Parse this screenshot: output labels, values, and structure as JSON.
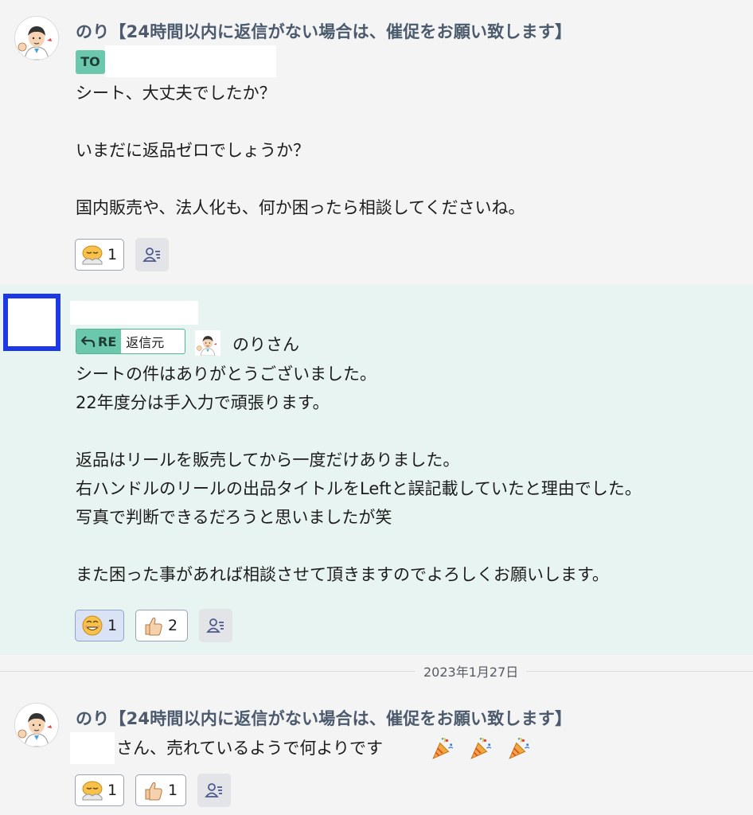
{
  "messages": [
    {
      "sender": "のり【24時間以内に返信がない場合は、催促をお願い致します】",
      "to_label": "TO",
      "lines": "シート、大丈夫でしたか？\n\nいまだに返品ゼロでしょうか？\n\n国内販売や、法人化も、何か困ったら相談してくださいね。",
      "reactions": [
        {
          "icon": "bow-emoji",
          "count": "1"
        }
      ],
      "readers_icon": "readers-list-icon"
    },
    {
      "reply_label": "RE",
      "reply_source": "返信元",
      "reply_to_name": "のりさん",
      "lines": "シートの件はありがとうございました。\n22年度分は手入力で頑張ります。\n\n返品はリールを販売してから一度だけありました。\n右ハンドルのリールの出品タイトルをLeftと誤記載していたと理由でした。\n写真で判断できるだろうと思いましたが笑\n\nまた困った事があれば相談させて頂きますのでよろしくお願いします。",
      "reactions": [
        {
          "icon": "grin-emoji",
          "count": "1"
        },
        {
          "icon": "thumbs-up-emoji",
          "count": "2"
        }
      ],
      "readers_icon": "readers-list-icon"
    },
    {
      "sender": "のり【24時間以内に返信がない場合は、催促をお願い致します】",
      "text": "さん、売れているようで何よりです",
      "party_icons": [
        "party-popper-icon",
        "party-popper-icon",
        "party-popper-icon"
      ],
      "reactions": [
        {
          "icon": "bow-emoji",
          "count": "1"
        },
        {
          "icon": "thumbs-up-emoji",
          "count": "1"
        }
      ],
      "readers_icon": "readers-list-icon"
    }
  ],
  "date_divider": "2023年1月27日",
  "colors": {
    "accent_green": "#6cc8ad",
    "highlight_bg": "#e8f4f1",
    "sender_color": "#4b5a6c",
    "avatar_border_blue": "#1d39e6"
  }
}
